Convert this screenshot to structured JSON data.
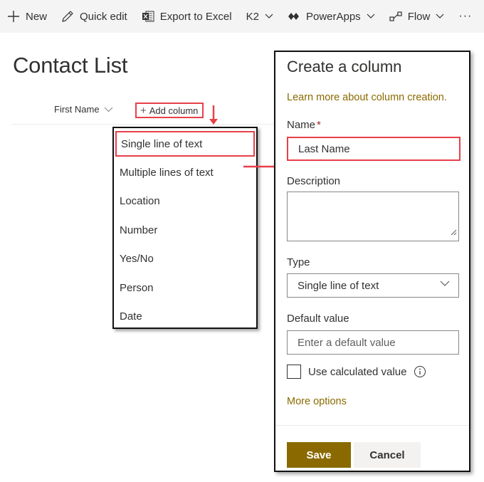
{
  "toolbar": {
    "new_label": "New",
    "quick_edit_label": "Quick edit",
    "export_label": "Export to Excel",
    "k2_label": "K2",
    "powerapps_label": "PowerApps",
    "flow_label": "Flow",
    "more_label": "···"
  },
  "page": {
    "title": "Contact List"
  },
  "list": {
    "column_first_name": "First Name",
    "add_column_label": "Add column"
  },
  "add_column_menu": {
    "items": [
      {
        "label": "Single line of text"
      },
      {
        "label": "Multiple lines of text"
      },
      {
        "label": "Location"
      },
      {
        "label": "Number"
      },
      {
        "label": "Yes/No"
      },
      {
        "label": "Person"
      },
      {
        "label": "Date"
      }
    ]
  },
  "panel": {
    "title": "Create a column",
    "learn_more_link": "Learn more about column creation.",
    "name_label": "Name",
    "name_required_mark": "*",
    "name_value": "Last Name",
    "description_label": "Description",
    "type_label": "Type",
    "type_value": "Single line of text",
    "default_value_label": "Default value",
    "default_value_placeholder": "Enter a default value",
    "calculated_label": "Use calculated value",
    "more_options_link": "More options",
    "save_label": "Save",
    "cancel_label": "Cancel"
  },
  "colors": {
    "accent": "#8a6a00",
    "highlight_box": "#e8404a",
    "toolbar_bg": "#f4f4f4"
  },
  "icons": [
    "plus-icon",
    "pencil-icon",
    "excel-icon",
    "chevron-down-icon",
    "powerapps-icon",
    "flow-icon",
    "info-icon",
    "resize-grip-icon",
    "red-arrow-icon"
  ]
}
